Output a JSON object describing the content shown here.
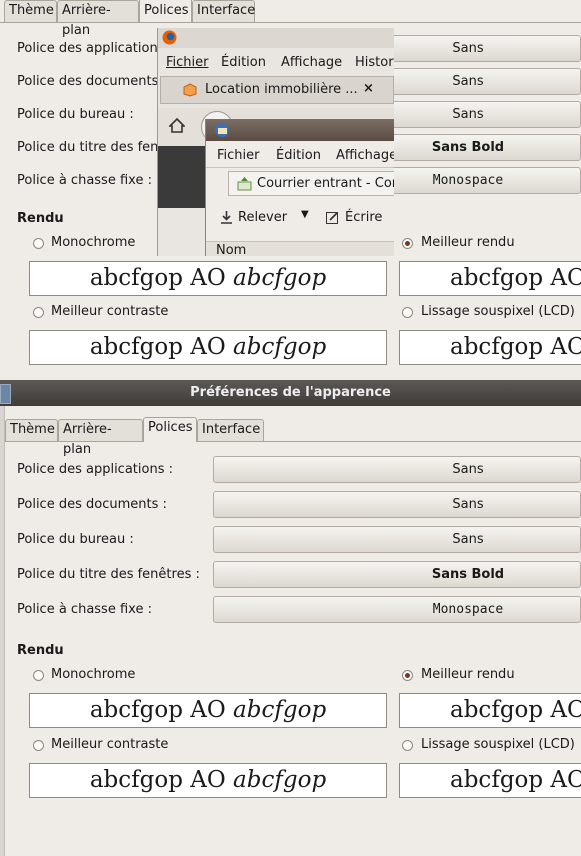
{
  "back": {
    "tabs": [
      "Thème",
      "Arrière-plan",
      "Polices",
      "Interface"
    ],
    "rows": [
      {
        "label": "Police des applications :",
        "value": "Sans"
      },
      {
        "label": "Police des documents :",
        "value": "Sans"
      },
      {
        "label": "Police du bureau :",
        "value": "Sans"
      },
      {
        "label": "Police du titre des fenêtres :",
        "value": "Sans Bold"
      },
      {
        "label": "Police à chasse fixe :",
        "value": "Monospace"
      }
    ],
    "section": "Rendu",
    "options": [
      "Monochrome",
      "Meilleur rendu",
      "Meilleur contraste",
      "Lissage souspixel (LCD)"
    ],
    "sample_regular": "abcfgop AO ",
    "sample_italic": "abcfgop",
    "sample_cut_right": "abcfgop AO"
  },
  "firefox": {
    "menu": [
      "Fichier",
      "Édition",
      "Affichage",
      "Histor"
    ],
    "tab_title": "Location immobilière ...",
    "tab_close": "×"
  },
  "thunderbird": {
    "menu": [
      "Fichier",
      "Édition",
      "Affichage"
    ],
    "folder": "Courrier entrant - Cor",
    "get_label": "Relever",
    "write_label": "Écrire",
    "column": "Nom"
  },
  "front": {
    "title": "Préférences de l'apparence",
    "tabs": [
      "Thème",
      "Arrière-plan",
      "Polices",
      "Interface"
    ],
    "rows": [
      {
        "label": "Police des applications :",
        "value": "Sans"
      },
      {
        "label": "Police des documents :",
        "value": "Sans"
      },
      {
        "label": "Police du bureau :",
        "value": "Sans"
      },
      {
        "label": "Police du titre des fenêtres :",
        "value": "Sans Bold"
      },
      {
        "label": "Police à chasse fixe :",
        "value": "Monospace"
      }
    ],
    "section": "Rendu",
    "options": [
      "Monochrome",
      "Meilleur rendu",
      "Meilleur contraste",
      "Lissage souspixel (LCD)"
    ],
    "selected_option": "Meilleur rendu",
    "sample_regular": "abcfgop AO ",
    "sample_italic": "abcfgop",
    "sample_cut_right": "abcfgop AO"
  }
}
